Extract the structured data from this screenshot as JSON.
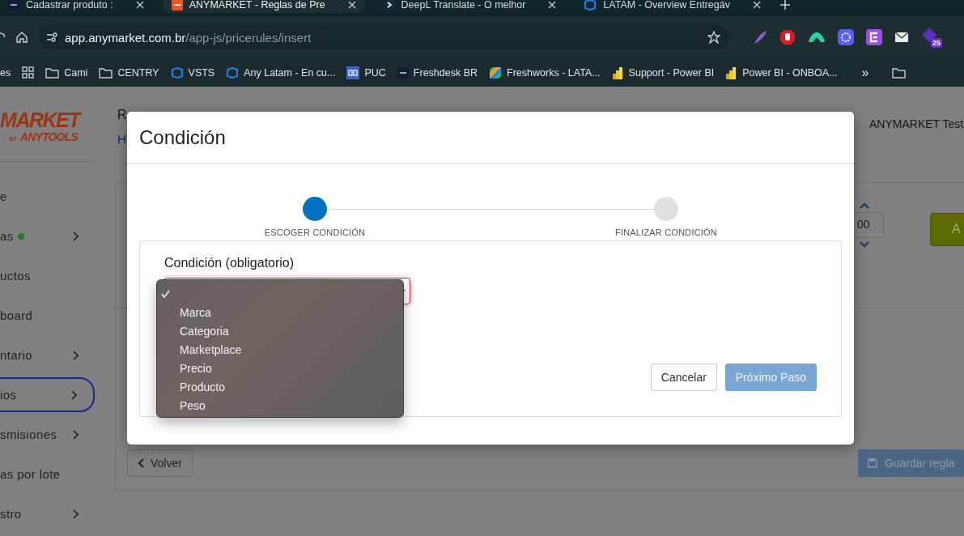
{
  "browser": {
    "tabs": [
      {
        "title": "Cadastrar produto :",
        "kind": "any",
        "selected": false
      },
      {
        "title": "ANYMARKET - Reglas de Pre",
        "kind": "any-orange",
        "selected": true
      },
      {
        "title": "DeepL Translate - O melhor",
        "kind": "deepl",
        "selected": false
      },
      {
        "title": "LATAM - Overview Entregáv",
        "kind": "azure",
        "selected": false
      }
    ],
    "url_host": "app.anymarket.com.br",
    "url_path": "/app-js/pricerules/insert",
    "extension_badge": "25",
    "bookmarks": [
      {
        "label": "es",
        "kind": "none"
      },
      {
        "kind": "apps"
      },
      {
        "label": "Cami",
        "kind": "folder"
      },
      {
        "label": "CENTRY",
        "kind": "folder"
      },
      {
        "label": "VSTS",
        "kind": "azure"
      },
      {
        "label": "Any Latam - En cu...",
        "kind": "azure"
      },
      {
        "label": "PUC",
        "kind": "ce"
      },
      {
        "label": "Freshdesk BR",
        "kind": "any"
      },
      {
        "label": "Freshworks - LATA...",
        "kind": "freshworks"
      },
      {
        "label": "Support - Power BI",
        "kind": "powerbi"
      },
      {
        "label": "Power BI - ONBOA...",
        "kind": "powerbi"
      },
      {
        "label": "»",
        "kind": "more"
      },
      {
        "kind": "folder"
      }
    ]
  },
  "sidebar": {
    "logo": {
      "main": "MARKET",
      "by": "BY",
      "sub": "ANYTOOLS"
    },
    "items": [
      {
        "label": "e",
        "expandable": false,
        "status_dot": false,
        "selected": false
      },
      {
        "label": "as",
        "expandable": true,
        "status_dot": true,
        "selected": false
      },
      {
        "label": "uctos",
        "expandable": false,
        "status_dot": false,
        "selected": false
      },
      {
        "label": "board",
        "expandable": false,
        "status_dot": false,
        "selected": false
      },
      {
        "label": "ntario",
        "expandable": true,
        "status_dot": false,
        "selected": false
      },
      {
        "label": "ios",
        "expandable": true,
        "status_dot": false,
        "selected": true
      },
      {
        "label": "smisiones",
        "expandable": true,
        "status_dot": false,
        "selected": false
      },
      {
        "label": "as por lote",
        "expandable": false,
        "status_dot": false,
        "selected": false
      },
      {
        "label": "stro",
        "expandable": true,
        "status_dot": false,
        "selected": false
      }
    ]
  },
  "page": {
    "title": "R",
    "breadcrumb": "H",
    "user": "ANYMARKET Test",
    "number_value": "00",
    "add_button": "A",
    "back_button": "Volver",
    "save_button": "Guardar regla"
  },
  "modal": {
    "title": "Condición",
    "steps": [
      {
        "label": "ESCOGER CONDICIÓN",
        "selected": true
      },
      {
        "label": "FINALIZAR CONDICIÓN",
        "selected": false
      }
    ],
    "field_label": "Condición (obligatorio)",
    "field_invalid": true,
    "blank_option_selected": true,
    "options": [
      {
        "label": "Marca",
        "selected": false
      },
      {
        "label": "Categoria",
        "selected": false
      },
      {
        "label": "Marketplace",
        "selected": false
      },
      {
        "label": "Precio",
        "selected": false
      },
      {
        "label": "Producto",
        "selected": false
      },
      {
        "label": "Peso",
        "selected": false
      }
    ],
    "cancel_button": "Cancelar",
    "next_button": {
      "label": "Próximo Paso",
      "disabled": true
    }
  }
}
